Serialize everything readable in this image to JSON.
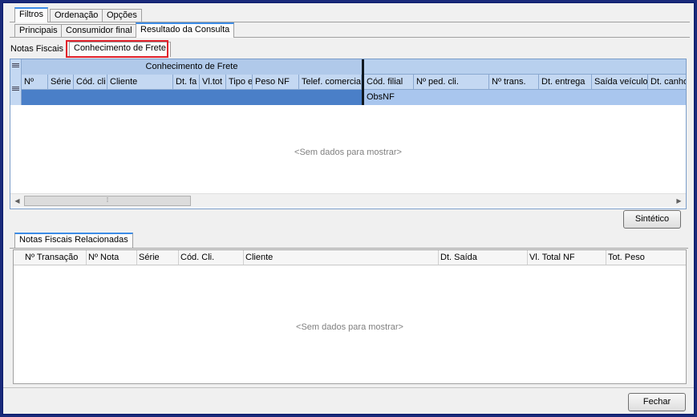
{
  "top_tabs": [
    "Filtros",
    "Ordenação",
    "Opções"
  ],
  "sub_tabs": [
    "Principais",
    "Consumidor final",
    "Resultado da Consulta"
  ],
  "result_tabs": [
    "Notas Fiscais",
    "Conhecimento de Frete"
  ],
  "grid": {
    "band_title": "Conhecimento de Frete",
    "columns_left": [
      "Nº",
      "Série",
      "Cód. cli",
      "Cliente",
      "Dt. fa",
      "Vl.tot",
      "Tipo e",
      "Peso NF",
      "Telef. comercia"
    ],
    "columns_right": [
      "Cód. filial",
      "Nº ped. cli.",
      "Nº trans.",
      "Dt. entrega",
      "Saída veículo",
      "Dt. canho"
    ],
    "obs_label": "ObsNF",
    "empty_text": "<Sem dados para mostrar>"
  },
  "sintetico_button": "Sintético",
  "lower_tab": "Notas Fiscais Relacionadas",
  "lower_grid": {
    "columns": [
      "Nº Transação",
      "Nº Nota",
      "Série",
      "Cód. Cli.",
      "Cliente",
      "Dt. Saída",
      "Vl. Total NF",
      "Tot. Peso"
    ],
    "empty_text": "<Sem dados para mostrar>"
  },
  "fechar_button": "Fechar"
}
